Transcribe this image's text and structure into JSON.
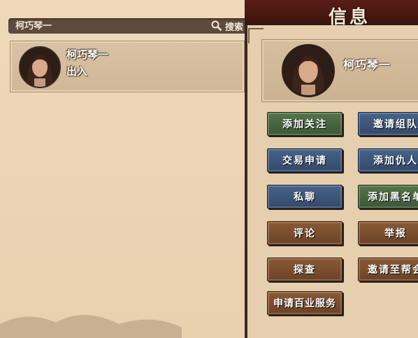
{
  "search": {
    "value": "柯巧琴一",
    "button_label": "搜索"
  },
  "friend": {
    "name": "柯巧琴一",
    "status": "出入"
  },
  "panel": {
    "title": "信息",
    "profile_name": "柯巧琴一",
    "buttons": [
      {
        "label": "添加关注",
        "color": "green"
      },
      {
        "label": "邀请组队",
        "color": "blue"
      },
      {
        "label": "交易申请",
        "color": "blue"
      },
      {
        "label": "添加仇人",
        "color": "blue"
      },
      {
        "label": "私聊",
        "color": "blue"
      },
      {
        "label": "添加黑名单",
        "color": "green"
      },
      {
        "label": "评论",
        "color": "brown"
      },
      {
        "label": "举报",
        "color": "brown"
      },
      {
        "label": "探查",
        "color": "brown"
      },
      {
        "label": "邀请至帮会",
        "color": "brown"
      },
      {
        "label": "申请百业服务",
        "color": "brown"
      }
    ]
  },
  "colors": {
    "green": "#4a6840",
    "blue": "#3d5679",
    "brown": "#7a4e2e"
  }
}
